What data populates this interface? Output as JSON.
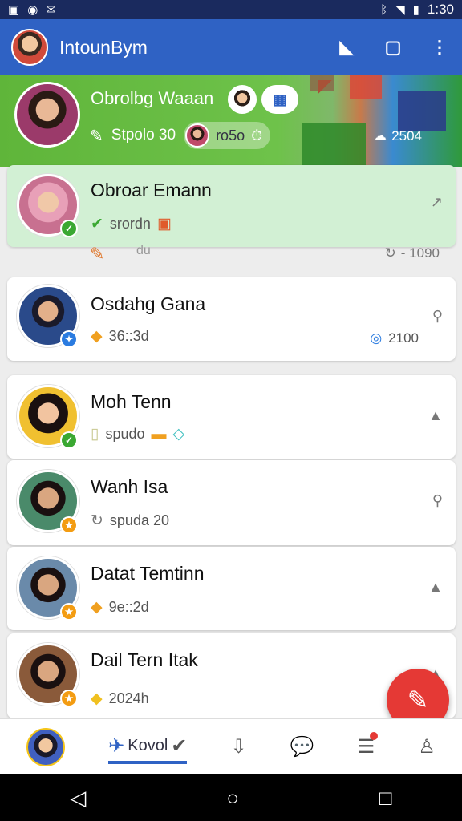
{
  "status_bar": {
    "left_icons": [
      "photo-icon",
      "circle-icon",
      "mail-icon"
    ],
    "time": "1:30"
  },
  "app_bar": {
    "title": "IntounBym",
    "actions": [
      "share-icon",
      "square-icon",
      "more-vert-icon"
    ]
  },
  "hero": {
    "name": "Obrolbg Waaan",
    "stat_text": "Stpolo 30",
    "pill_text": "ro5o",
    "right_text": "2504"
  },
  "contacts": [
    {
      "name": "Obroar Emann",
      "meta": "srordn",
      "trail_icon": "arrow-icon",
      "badge_color": "#3aa832",
      "selected": true
    },
    {
      "name": "Osdahg Gana",
      "meta": "36::3d",
      "trail_icon": "search-icon",
      "extra": "2100",
      "badge_color": "#2a7be0",
      "selected": false
    },
    {
      "name": "Moh Tenn",
      "meta": "spudo",
      "trail_icon": "lock-icon",
      "badge_color": "#3aa832",
      "selected": false
    },
    {
      "name": "Wanh Isa",
      "meta": "spuda 20",
      "trail_icon": "pin-icon",
      "badge_color": "#f39c12",
      "selected": false
    },
    {
      "name": "Datat Temtinn",
      "meta": "9e::2d",
      "trail_icon": "lock-icon",
      "badge_color": "#f39c12",
      "selected": false
    },
    {
      "name": "Dail Tern Itak",
      "meta": "2024h",
      "trail_icon": "lock-icon",
      "badge_color": "#f39c12",
      "selected": false
    }
  ],
  "between_row": {
    "left_text": "du",
    "right_text": "- 1090"
  },
  "bottom_nav": {
    "active_label": "Kovol"
  },
  "colors": {
    "primary": "#2f62c4",
    "accent": "#e53935",
    "hero_green": "#5fb53a"
  }
}
